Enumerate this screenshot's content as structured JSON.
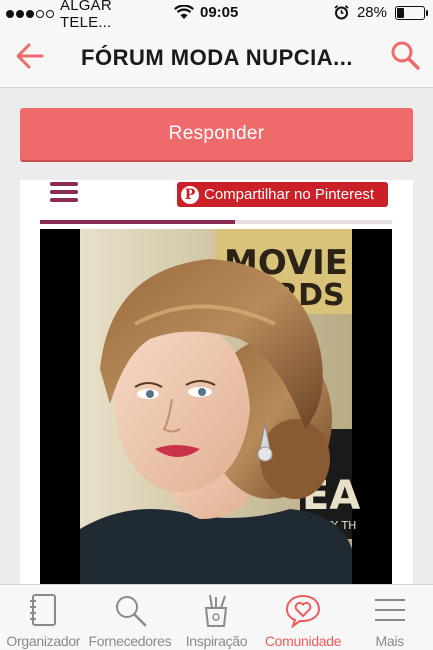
{
  "status_bar": {
    "carrier": "ALGAR TELE...",
    "time": "09:05",
    "battery": "28%",
    "battery_level": 0.28,
    "signal_bars_filled": 3,
    "signal_bars_total": 5
  },
  "header": {
    "title": "FÓRUM MODA NUPCIA...",
    "back_icon": "arrow-left-icon",
    "search_icon": "search-icon"
  },
  "actions": {
    "reply_label": "Responder"
  },
  "post": {
    "pinterest_label": "Compartilhar no Pinterest",
    "image_alt": "photo-of-bride-hairstyle",
    "backdrop_text_top": "MOVIE",
    "backdrop_text_mid": "RDS",
    "backdrop_text_right": "EA",
    "backdrop_text_small": "EAUTY TH"
  },
  "tabs": [
    {
      "label": "Organizador",
      "icon": "notebook-icon",
      "active": false
    },
    {
      "label": "Fornecedores",
      "icon": "search-icon",
      "active": false
    },
    {
      "label": "Inspiração",
      "icon": "brushes-icon",
      "active": false
    },
    {
      "label": "Comunidade",
      "icon": "chat-heart-icon",
      "active": true
    },
    {
      "label": "Mais",
      "icon": "menu-icon",
      "active": false
    }
  ],
  "colors": {
    "accent": "#ef6b6b",
    "pinterest": "#cb2027",
    "brand_purple": "#8b2a52"
  }
}
